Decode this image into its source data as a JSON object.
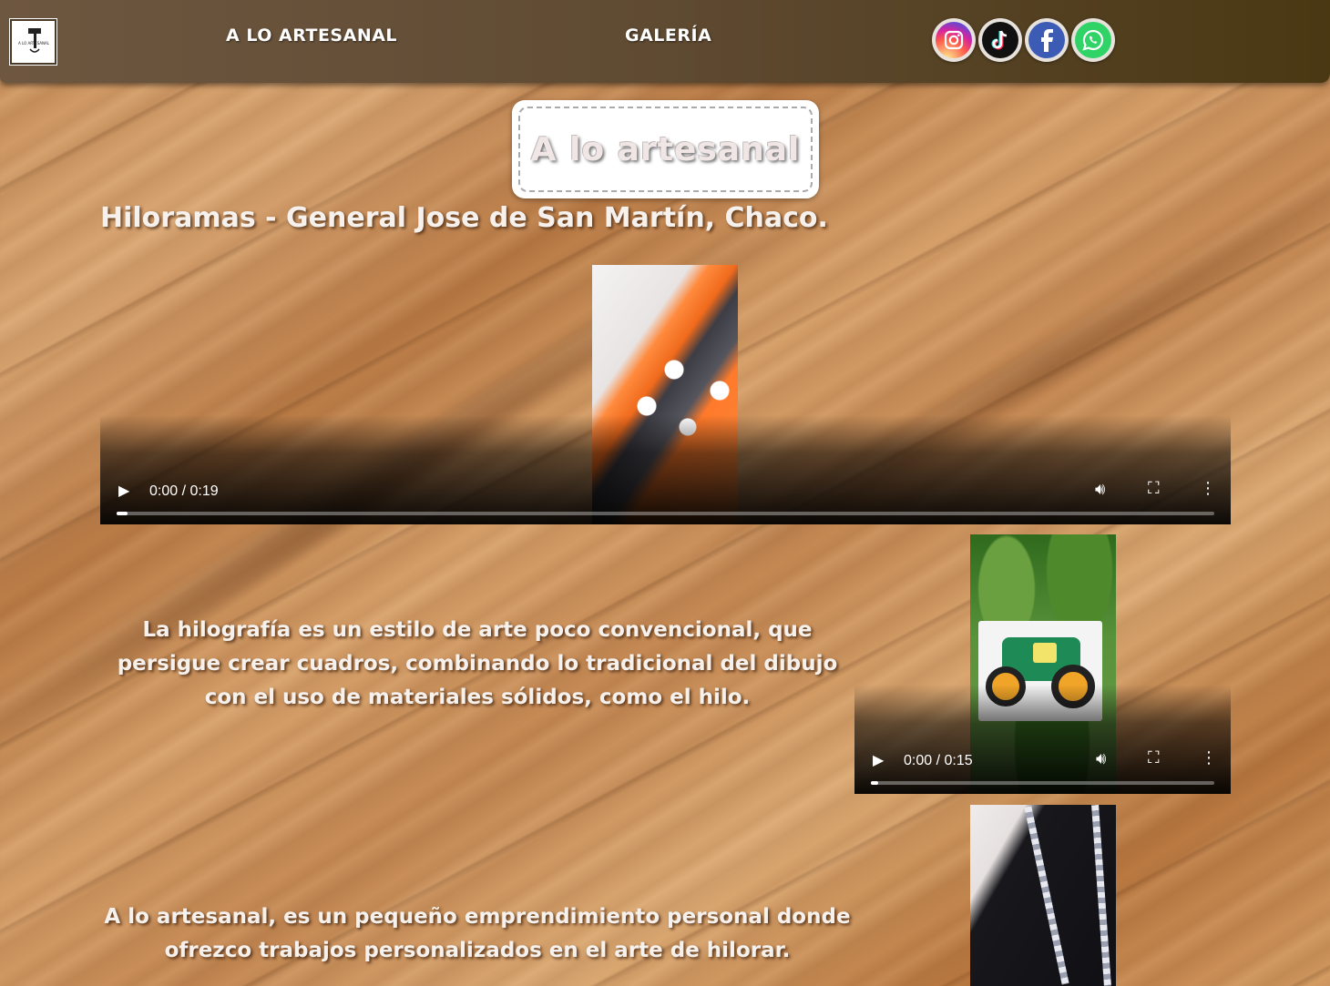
{
  "nav": {
    "logo_text": "A LO ARTESANAL",
    "links": [
      "A LO ARTESANAL",
      "GALERÍA"
    ],
    "social": [
      {
        "name": "instagram-icon",
        "color": "#d6249f"
      },
      {
        "name": "tiktok-icon",
        "color": "#111111"
      },
      {
        "name": "facebook-icon",
        "color": "#3b5bb5"
      },
      {
        "name": "whatsapp-icon",
        "color": "#2fd366"
      }
    ]
  },
  "hero": {
    "title": "A lo artesanal",
    "subtitle": "Hiloramas - General Jose de San Martín, Chaco."
  },
  "videos": [
    {
      "time": "0:00 / 0:19",
      "progress": 0.01
    },
    {
      "time": "0:00 / 0:15",
      "progress": 0.02
    },
    {
      "time": "",
      "progress": 0
    }
  ],
  "paragraphs": [
    "La hilografía es un estilo de arte poco convencional, que persigue crear cuadros, combinando lo tradicional del dibujo con el uso de materiales sólidos, como el hilo.",
    "A lo artesanal, es un pequeño emprendimiento personal donde ofrezco trabajos personalizados en el arte de hilorar."
  ],
  "colors": {
    "nav_start": "#6e5740",
    "nav_end": "#4a3813",
    "text": "#f6f1ec"
  }
}
